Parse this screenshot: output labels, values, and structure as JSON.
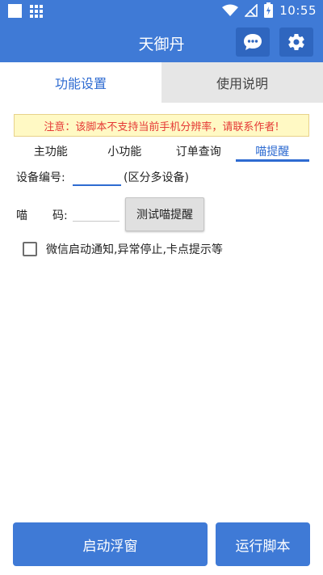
{
  "status_bar": {
    "time": "10:55",
    "icons": [
      "notification-square-icon",
      "grid-app-icon",
      "wifi-icon",
      "no-signal-icon",
      "battery-charging-icon"
    ]
  },
  "app_bar": {
    "title": "天御丹",
    "buttons": [
      "chat-icon",
      "gear-icon"
    ]
  },
  "tabs": [
    {
      "label": "功能设置",
      "active": true
    },
    {
      "label": "使用说明",
      "active": false
    }
  ],
  "notice": "注意：该脚本不支持当前手机分辨率，请联系作者!",
  "subtabs": [
    {
      "label": "主功能",
      "active": false
    },
    {
      "label": "小功能",
      "active": false
    },
    {
      "label": "订单查询",
      "active": false
    },
    {
      "label": "喵提醒",
      "active": true
    }
  ],
  "form": {
    "device_label": "设备编号:",
    "device_value": "",
    "device_hint": "(区分多设备)",
    "code_label_1": "喵",
    "code_label_2": "码:",
    "code_value": "",
    "test_button": "测试喵提醒",
    "checkbox_label": "微信启动通知,异常停止,卡点提示等",
    "checkbox_checked": false
  },
  "bottom": {
    "float_button": "启动浮窗",
    "run_button": "运行脚本"
  },
  "colors": {
    "primary": "#3f7ad6",
    "accent_text": "#2e6bd1",
    "notice_bg": "#fff9c4",
    "notice_text": "#e53935"
  }
}
